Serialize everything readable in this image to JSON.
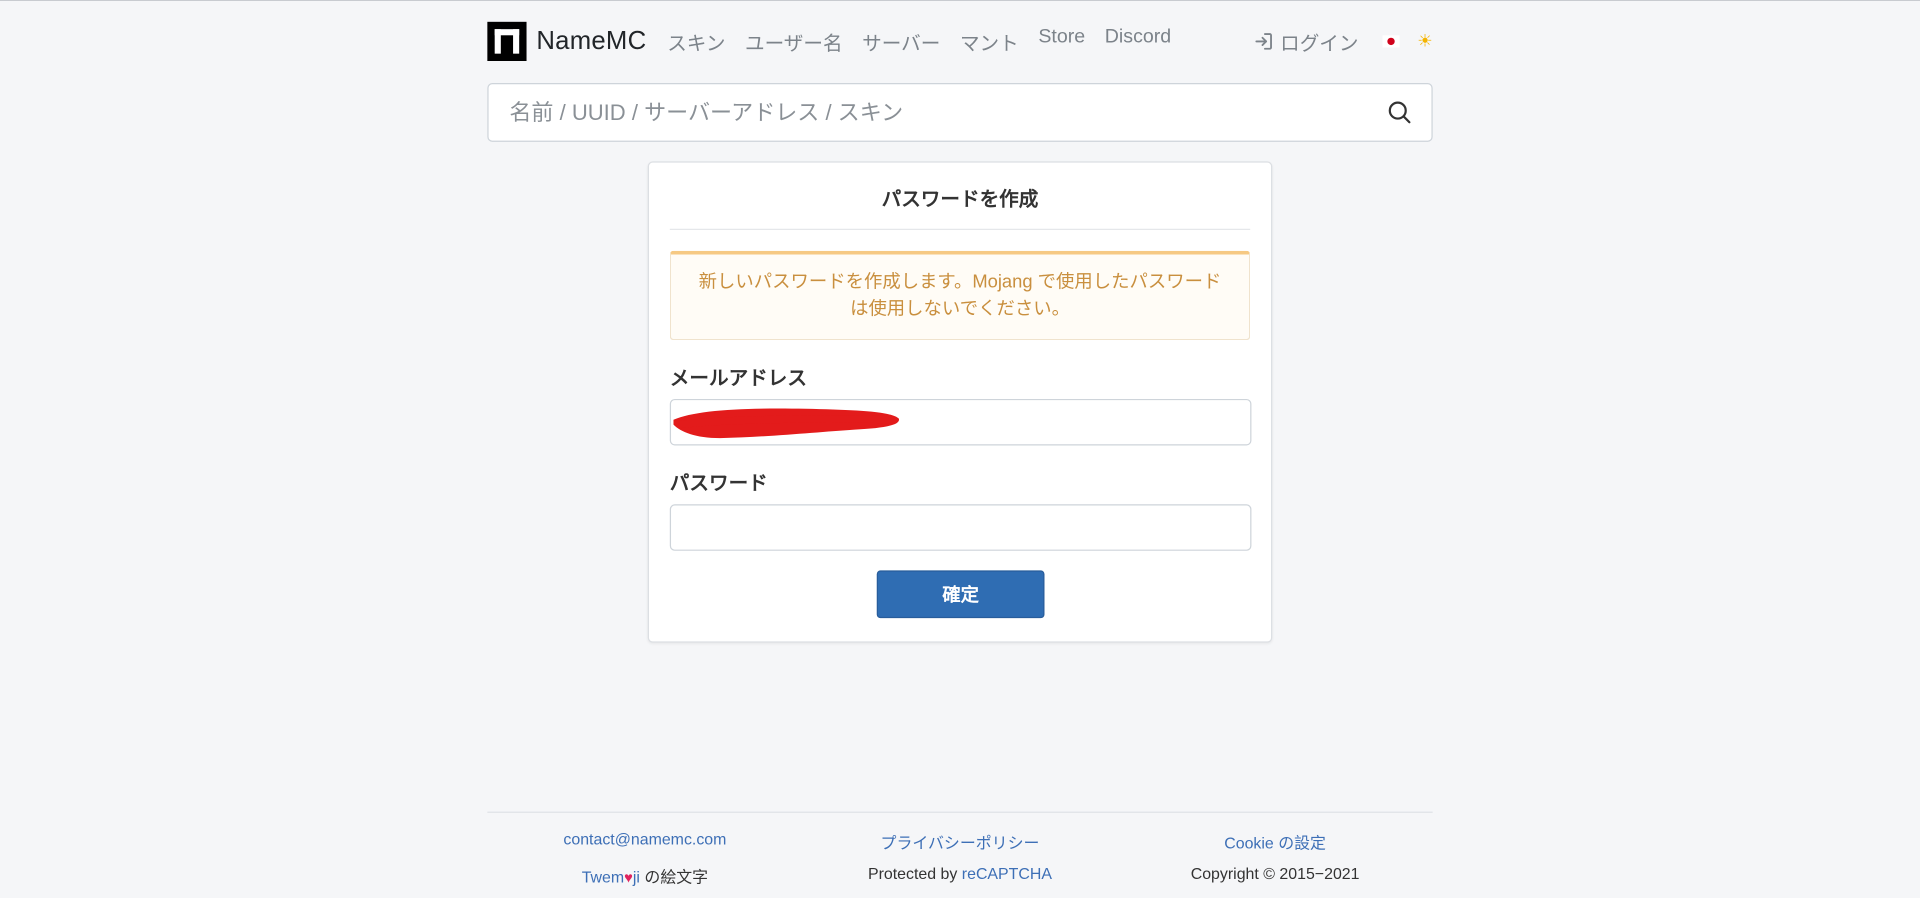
{
  "navbar": {
    "brand": "NameMC",
    "links": [
      "スキン",
      "ユーザー名",
      "サーバー",
      "マント",
      "Store",
      "Discord"
    ],
    "login_label": "ログイン",
    "language_flag": "japan-flag-icon",
    "theme_icon": "sun-icon"
  },
  "search": {
    "placeholder": "名前 / UUID / サーバーアドレス / スキン"
  },
  "form": {
    "title": "パスワードを作成",
    "alert_line1": "新しいパスワードを作成します。Mojang で使用したパスワード",
    "alert_line2": "は使用しないでください。",
    "email_label": "メールアドレス",
    "email_value": "",
    "password_label": "パスワード",
    "password_value": "",
    "submit_label": "確定"
  },
  "footer": {
    "contact": "contact@namemc.com",
    "privacy": "プライバシーポリシー",
    "cookie": "Cookie の設定",
    "twemoji_prefix": "Twem",
    "twemoji_suffix": "ji",
    "twemoji_text": " の絵文字",
    "protected_prefix": "Protected by ",
    "recaptcha": "reCAPTCHA",
    "copyright": "Copyright © 2015−2021"
  },
  "colors": {
    "primary": "#2f6db3",
    "link": "#3d6fb6",
    "alert_text": "#c98f3e",
    "alert_border": "#f6c983",
    "redaction": "#e31b1b"
  }
}
